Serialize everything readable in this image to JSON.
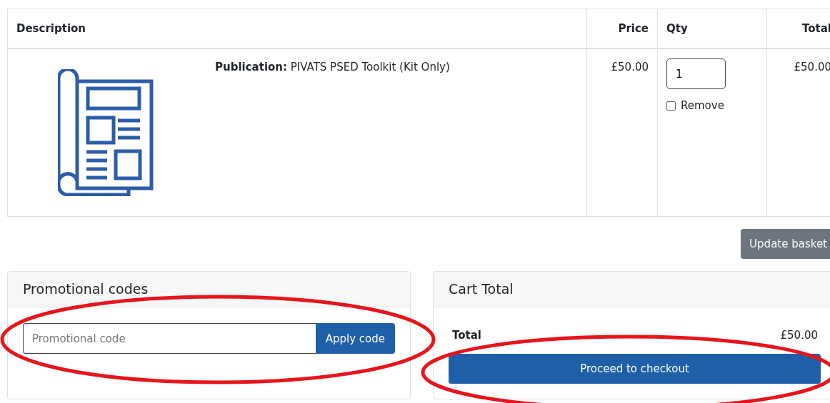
{
  "basket": {
    "columns": [
      "Description",
      "Price",
      "Qty",
      "Total"
    ],
    "rows": [
      {
        "description": "**Publication:** PIVATS PSED Toolkit (Kit Only)",
        "price": "£50.00",
        "qty": "1",
        "remove": {
          "label": "Remove",
          "checked": false
        },
        "total": "£50.00"
      }
    ]
  },
  "update_button": "Update basket",
  "promo_card": {
    "title": "Promotional codes",
    "placeholder": "Promotional code",
    "button": "Apply code"
  },
  "cart_card": {
    "title": "Cart Total",
    "total_label": "Total",
    "total_value": "£50.00",
    "button": "Proceed to checkout"
  }
}
